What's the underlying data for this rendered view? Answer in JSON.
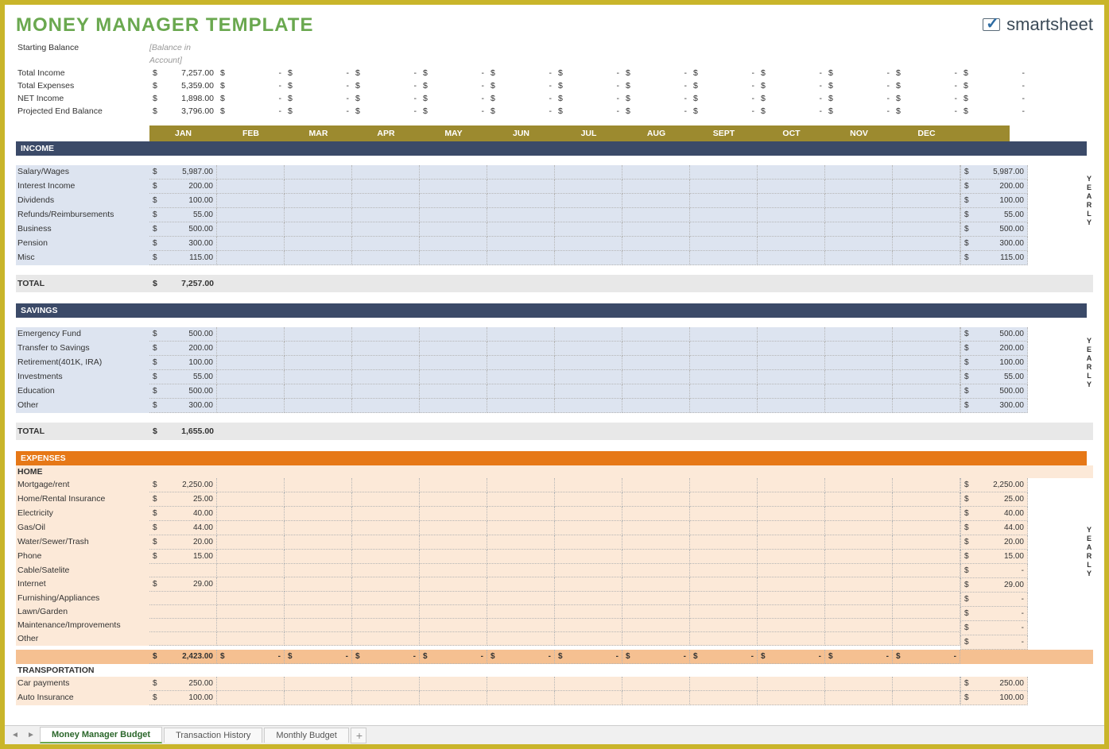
{
  "title": "MONEY MANAGER TEMPLATE",
  "brand": "smartsheet",
  "months": [
    "JAN",
    "FEB",
    "MAR",
    "APR",
    "MAY",
    "JUN",
    "JUL",
    "AUG",
    "SEPT",
    "OCT",
    "NOV",
    "DEC"
  ],
  "summary": {
    "starting_balance": {
      "label": "Starting Balance",
      "placeholder": "[Balance in Account]"
    },
    "rows": [
      {
        "label": "Total Income",
        "jan": "7,257.00"
      },
      {
        "label": "Total Expenses",
        "jan": "5,359.00"
      },
      {
        "label": "NET Income",
        "jan": "1,898.00"
      },
      {
        "label": "Projected End Balance",
        "jan": "3,796.00"
      }
    ]
  },
  "yearly_label": "YEARLY",
  "sections": {
    "income": {
      "title": "INCOME",
      "rows": [
        {
          "label": "Salary/Wages",
          "jan": "5,987.00",
          "yearly": "5,987.00"
        },
        {
          "label": "Interest Income",
          "jan": "200.00",
          "yearly": "200.00"
        },
        {
          "label": "Dividends",
          "jan": "100.00",
          "yearly": "100.00"
        },
        {
          "label": "Refunds/Reimbursements",
          "jan": "55.00",
          "yearly": "55.00"
        },
        {
          "label": "Business",
          "jan": "500.00",
          "yearly": "500.00"
        },
        {
          "label": "Pension",
          "jan": "300.00",
          "yearly": "300.00"
        },
        {
          "label": "Misc",
          "jan": "115.00",
          "yearly": "115.00"
        }
      ],
      "total_label": "TOTAL",
      "total": "7,257.00"
    },
    "savings": {
      "title": "SAVINGS",
      "rows": [
        {
          "label": "Emergency Fund",
          "jan": "500.00",
          "yearly": "500.00"
        },
        {
          "label": "Transfer to Savings",
          "jan": "200.00",
          "yearly": "200.00"
        },
        {
          "label": "Retirement(401K, IRA)",
          "jan": "100.00",
          "yearly": "100.00"
        },
        {
          "label": "Investments",
          "jan": "55.00",
          "yearly": "55.00"
        },
        {
          "label": "Education",
          "jan": "500.00",
          "yearly": "500.00"
        },
        {
          "label": "Other",
          "jan": "300.00",
          "yearly": "300.00"
        }
      ],
      "total_label": "TOTAL",
      "total": "1,655.00"
    },
    "expenses": {
      "title": "EXPENSES",
      "home": {
        "title": "HOME",
        "rows": [
          {
            "label": "Mortgage/rent",
            "jan": "2,250.00",
            "yearly": "2,250.00"
          },
          {
            "label": "Home/Rental Insurance",
            "jan": "25.00",
            "yearly": "25.00"
          },
          {
            "label": "Electricity",
            "jan": "40.00",
            "yearly": "40.00"
          },
          {
            "label": "Gas/Oil",
            "jan": "44.00",
            "yearly": "44.00"
          },
          {
            "label": "Water/Sewer/Trash",
            "jan": "20.00",
            "yearly": "20.00"
          },
          {
            "label": "Phone",
            "jan": "15.00",
            "yearly": "15.00"
          },
          {
            "label": "Cable/Satelite",
            "jan": "",
            "yearly": "-"
          },
          {
            "label": "Internet",
            "jan": "29.00",
            "yearly": "29.00"
          },
          {
            "label": "Furnishing/Appliances",
            "jan": "",
            "yearly": "-"
          },
          {
            "label": "Lawn/Garden",
            "jan": "",
            "yearly": "-"
          },
          {
            "label": "Maintenance/Improvements",
            "jan": "",
            "yearly": "-"
          },
          {
            "label": "Other",
            "jan": "",
            "yearly": "-"
          }
        ],
        "subtotal": "2,423.00"
      },
      "transportation": {
        "title": "TRANSPORTATION",
        "rows": [
          {
            "label": "Car payments",
            "jan": "250.00",
            "yearly": "250.00"
          },
          {
            "label": "Auto Insurance",
            "jan": "100.00",
            "yearly": "100.00"
          }
        ]
      }
    }
  },
  "tabs": {
    "active": "Money Manager Budget",
    "others": [
      "Transaction History",
      "Monthly Budget"
    ]
  }
}
